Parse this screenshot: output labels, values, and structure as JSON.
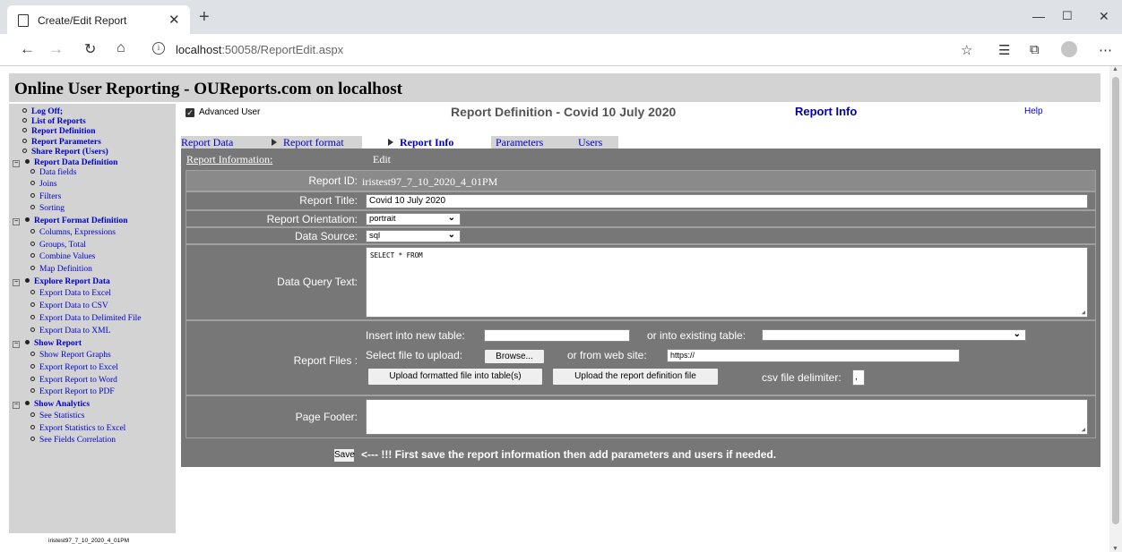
{
  "browser": {
    "tab_title": "Create/Edit Report",
    "url_host": "localhost",
    "url_rest": ":50058/ReportEdit.aspx"
  },
  "header": {
    "title": "Online User Reporting - OUReports.com on localhost"
  },
  "menu": [
    {
      "label": "Log Off;",
      "kind": "item"
    },
    {
      "label": "List of Reports",
      "kind": "item"
    },
    {
      "label": "Report Definition",
      "kind": "item"
    },
    {
      "label": "Report Parameters",
      "kind": "item"
    },
    {
      "label": "Share Report (Users)",
      "kind": "item"
    },
    {
      "label": "Report Data Definition",
      "kind": "group"
    },
    {
      "label": "Data fields",
      "kind": "sub"
    },
    {
      "label": "Joins",
      "kind": "sub"
    },
    {
      "label": "Filters",
      "kind": "sub"
    },
    {
      "label": "Sorting",
      "kind": "sub"
    },
    {
      "label": "Report Format Definition",
      "kind": "group"
    },
    {
      "label": "Columns, Expressions",
      "kind": "sub"
    },
    {
      "label": "Groups, Total",
      "kind": "sub"
    },
    {
      "label": "Combine Values",
      "kind": "sub"
    },
    {
      "label": "Map Definition",
      "kind": "sub"
    },
    {
      "label": "Explore Report Data",
      "kind": "group"
    },
    {
      "label": "Export Data to Excel",
      "kind": "sub"
    },
    {
      "label": "Export Data to CSV",
      "kind": "sub"
    },
    {
      "label": "Export Data to Delimited File",
      "kind": "sub"
    },
    {
      "label": "Export Data to XML",
      "kind": "sub"
    },
    {
      "label": "Show Report",
      "kind": "group"
    },
    {
      "label": "Show Report Graphs",
      "kind": "sub"
    },
    {
      "label": "Export Report to Excel",
      "kind": "sub"
    },
    {
      "label": "Export Report to Word",
      "kind": "sub"
    },
    {
      "label": "Export Report to PDF",
      "kind": "sub"
    },
    {
      "label": "Show Analytics",
      "kind": "group"
    },
    {
      "label": "See Statistics",
      "kind": "sub"
    },
    {
      "label": "Export Statistics to Excel",
      "kind": "sub"
    },
    {
      "label": "See Fields Correlation",
      "kind": "sub"
    }
  ],
  "user_id_footer": "iristest97_7_10_2020_4_01PM",
  "top": {
    "advanced_user": "Advanced User",
    "report_def_title": "Report Definition - Covid 10 July 2020",
    "report_info": "Report Info",
    "help": "Help"
  },
  "tabs": {
    "report_data": "Report Data",
    "report_format": "Report format",
    "report_info": "Report Info",
    "parameters": "Parameters",
    "users": "Users"
  },
  "form": {
    "section_link": "Report Information:",
    "edit": "Edit",
    "report_id_label": "Report ID:",
    "report_id_value": "iristest97_7_10_2020_4_01PM",
    "report_title_label": "Report Title:",
    "report_title_value": "Covid 10 July 2020",
    "orientation_label": "Report Orientation:",
    "orientation_value": "portrait",
    "data_source_label": "Data Source:",
    "data_source_value": "sql",
    "query_label": "Data Query Text:",
    "query_value": "SELECT  * FROM",
    "files_label": "Report Files :",
    "insert_new_table": "Insert into new table:",
    "or_existing_table": "or into existing table:",
    "select_file": "Select file to upload:",
    "browse": "Browse...",
    "or_web_site": "or from web site:",
    "web_site_value": "https://",
    "upload_formatted": "Upload formatted file into table(s)",
    "upload_definition": "Upload the report definition file",
    "csv_delimiter_label": "csv file delimiter:",
    "csv_delimiter_value": ",",
    "page_footer_label": "Page Footer:",
    "save": "Save",
    "save_message": "<--- !!!  First save the report information then add parameters and users if needed."
  }
}
